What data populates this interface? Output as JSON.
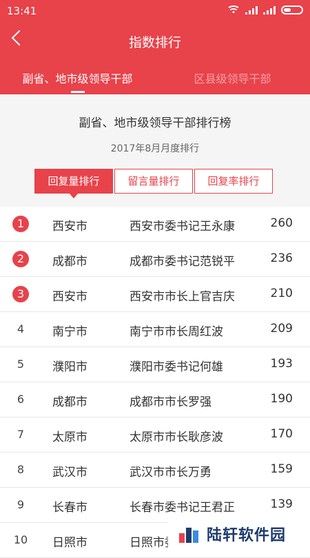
{
  "status_bar": {
    "time": "13:41"
  },
  "header": {
    "title": "指数排行",
    "tabs": [
      {
        "label": "副省、地市级领导干部",
        "active": true
      },
      {
        "label": "区县级领导干部",
        "active": false
      }
    ]
  },
  "section": {
    "title": "副省、地市级领导干部排行榜",
    "subtitle": "2017年8月月度排行"
  },
  "segments": [
    {
      "label": "回复量排行",
      "active": true
    },
    {
      "label": "留言量排行",
      "active": false
    },
    {
      "label": "回复率排行",
      "active": false
    }
  ],
  "rankings": [
    {
      "rank": "1",
      "city": "西安市",
      "official": "西安市委书记王永康",
      "score": "260"
    },
    {
      "rank": "2",
      "city": "成都市",
      "official": "成都市委书记范锐平",
      "score": "236"
    },
    {
      "rank": "3",
      "city": "西安市",
      "official": "西安市市长上官吉庆",
      "score": "210"
    },
    {
      "rank": "4",
      "city": "南宁市",
      "official": "南宁市市长周红波",
      "score": "209"
    },
    {
      "rank": "5",
      "city": "濮阳市",
      "official": "濮阳市委书记何雄",
      "score": "193"
    },
    {
      "rank": "6",
      "city": "成都市",
      "official": "成都市市长罗强",
      "score": "190"
    },
    {
      "rank": "7",
      "city": "太原市",
      "official": "太原市市长耿彦波",
      "score": "170"
    },
    {
      "rank": "8",
      "city": "武汉市",
      "official": "武汉市市长万勇",
      "score": "159"
    },
    {
      "rank": "9",
      "city": "长春市",
      "official": "长春市委书记王君正",
      "score": "139"
    },
    {
      "rank": "10",
      "city": "日照市",
      "official": "日照市委",
      "score": ""
    }
  ],
  "watermark": {
    "text": "陆轩软件园"
  },
  "colors": {
    "accent": "#e8424b"
  }
}
